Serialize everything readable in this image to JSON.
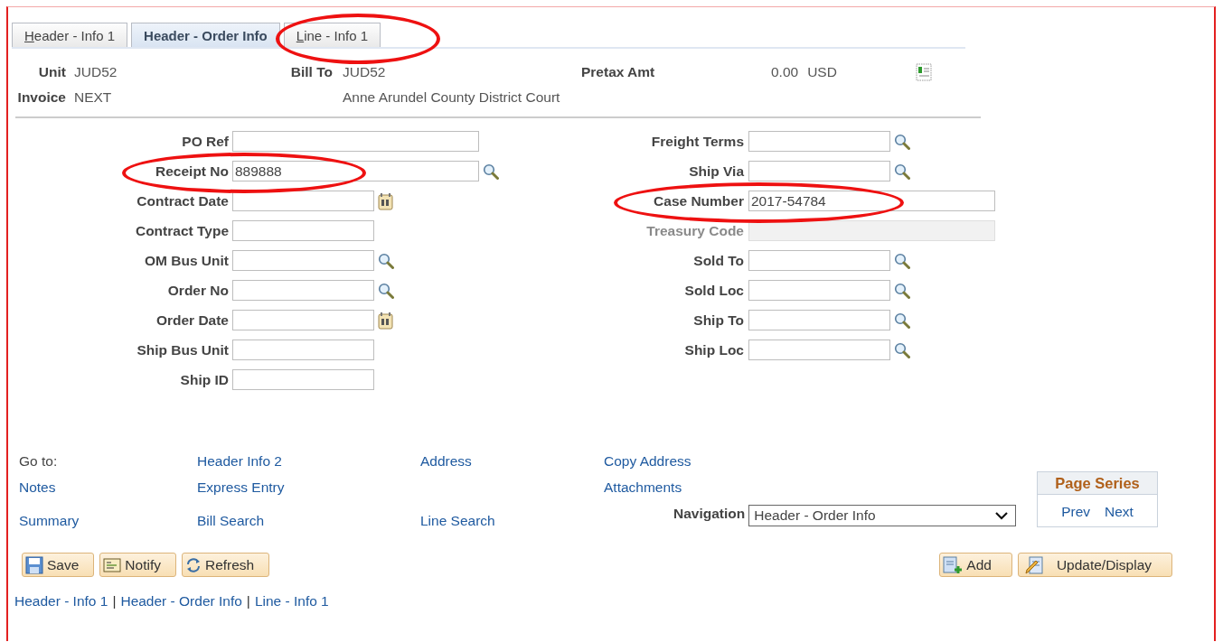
{
  "tabs": [
    {
      "label": "Header - Info 1",
      "selected": false,
      "mnemonic": true,
      "circled": false
    },
    {
      "label": "Header - Order Info",
      "selected": true,
      "mnemonic": false,
      "circled": false
    },
    {
      "label": "Line - Info 1",
      "selected": false,
      "mnemonic": true,
      "circled": true
    }
  ],
  "header": {
    "unit": {
      "label": "Unit",
      "value": "JUD52"
    },
    "invoice": {
      "label": "Invoice",
      "value": "NEXT"
    },
    "bill_to": {
      "label": "Bill To",
      "value": "JUD52",
      "name": "Anne Arundel County District Court"
    },
    "pretax": {
      "label": "Pretax Amt",
      "amount": "0.00",
      "currency": "USD"
    }
  },
  "left_fields": [
    {
      "label": "PO Ref",
      "kind": "text",
      "long": true,
      "disabled": false,
      "circled": false
    },
    {
      "label": "Receipt No",
      "value": "889888",
      "kind": "lookup",
      "long": true,
      "disabled": false,
      "circled": true
    },
    {
      "label": "Contract Date",
      "kind": "date",
      "long": false,
      "disabled": false,
      "circled": false
    },
    {
      "label": "Contract Type",
      "kind": "text",
      "long": false,
      "disabled": false,
      "circled": false
    },
    {
      "label": "OM Bus Unit",
      "kind": "lookup",
      "long": false,
      "disabled": false,
      "circled": false
    },
    {
      "label": "Order No",
      "kind": "lookup",
      "long": false,
      "disabled": false,
      "circled": false
    },
    {
      "label": "Order Date",
      "kind": "date",
      "long": false,
      "disabled": false,
      "circled": false
    },
    {
      "label": "Ship Bus Unit",
      "kind": "text",
      "long": false,
      "disabled": false,
      "circled": false
    },
    {
      "label": "Ship ID",
      "kind": "text",
      "long": false,
      "disabled": false,
      "circled": false
    }
  ],
  "right_fields": [
    {
      "label": "Freight Terms",
      "kind": "lookup",
      "long": false,
      "disabled": false,
      "circled": false
    },
    {
      "label": "Ship Via",
      "kind": "lookup",
      "long": false,
      "disabled": false,
      "circled": false
    },
    {
      "label": "Case Number",
      "value": "2017-54784",
      "kind": "text",
      "long": true,
      "disabled": false,
      "circled": true
    },
    {
      "label": "Treasury Code",
      "kind": "text",
      "long": true,
      "disabled": true,
      "circled": false
    },
    {
      "label": "Sold To",
      "kind": "lookup",
      "long": false,
      "disabled": false,
      "circled": false
    },
    {
      "label": "Sold Loc",
      "kind": "lookup",
      "long": false,
      "disabled": false,
      "circled": false
    },
    {
      "label": "Ship To",
      "kind": "lookup",
      "long": false,
      "disabled": false,
      "circled": false
    },
    {
      "label": "Ship Loc",
      "kind": "lookup",
      "long": false,
      "disabled": false,
      "circled": false
    }
  ],
  "link_rows": [
    [
      {
        "kind": "label",
        "text": "Go to:"
      },
      {
        "kind": "link",
        "text": "Header Info 2"
      },
      {
        "kind": "link",
        "text": "Address"
      },
      {
        "kind": "link",
        "text": "Copy Address"
      }
    ],
    [
      {
        "kind": "link",
        "text": "Notes"
      },
      {
        "kind": "link",
        "text": "Express Entry"
      },
      {
        "kind": "blank"
      },
      {
        "kind": "link",
        "text": "Attachments"
      }
    ],
    [
      {
        "kind": "link",
        "text": "Summary"
      },
      {
        "kind": "link",
        "text": "Bill Search"
      },
      {
        "kind": "link",
        "text": "Line Search"
      },
      {
        "kind": "navigation"
      }
    ]
  ],
  "navigation": {
    "label": "Navigation",
    "value": "Header - Order Info"
  },
  "page_series": {
    "title": "Page Series",
    "links": [
      "Prev",
      "Next"
    ]
  },
  "buttons_left": [
    {
      "label": "Save",
      "kind": "save"
    },
    {
      "label": "Notify",
      "kind": "notify"
    },
    {
      "label": "Refresh",
      "kind": "refresh"
    }
  ],
  "buttons_right": [
    {
      "label": "Add",
      "kind": "add"
    },
    {
      "label": "Update/Display",
      "kind": "update"
    }
  ],
  "footer": {
    "links": [
      "Header - Info 1",
      "Header - Order Info",
      "Line - Info 1"
    ],
    "separator": "|"
  }
}
